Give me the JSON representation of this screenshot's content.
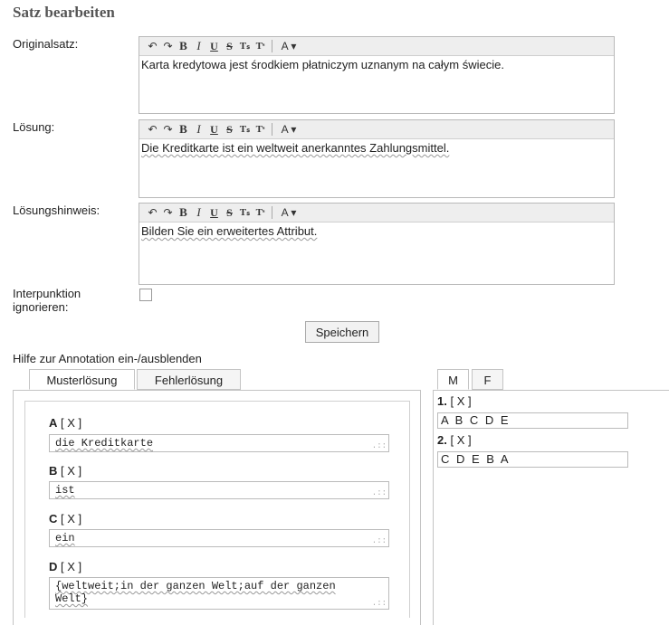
{
  "title": "Satz bearbeiten",
  "toolbar": {
    "undo": "↶",
    "redo": "↷",
    "bold": "B",
    "italic": "I",
    "underline": "U",
    "strike": "S",
    "subscript": "Tₛ",
    "superscript": "Tˢ",
    "color": "A ▾"
  },
  "fields": {
    "original": {
      "label": "Originalsatz:",
      "value": "Karta kredytowa jest środkiem płatniczym uznanym na całym świecie."
    },
    "solution": {
      "label": "Lösung:",
      "value": "Die Kreditkarte ist ein weltweit anerkanntes Zahlungsmittel."
    },
    "hint": {
      "label": "Lösungshinweis:",
      "value": "Bilden Sie ein erweitertes Attribut."
    },
    "punctuation": {
      "label": "Interpunktion ignorieren:",
      "checked": false
    }
  },
  "save_label": "Speichern",
  "annotation_toggle": "Hilfe zur Annotation ein-/ausblenden",
  "tabs": {
    "left": [
      "Musterlösung",
      "Fehlerlösung"
    ],
    "right": [
      "M",
      "F"
    ]
  },
  "annotations": [
    {
      "letter": "A",
      "remove": "[ X ]",
      "value": "die Kreditkarte"
    },
    {
      "letter": "B",
      "remove": "[ X ]",
      "value": "ist"
    },
    {
      "letter": "C",
      "remove": "[ X ]",
      "value": "ein"
    },
    {
      "letter": "D",
      "remove": "[ X ]",
      "value": "{weltweit;in der ganzen Welt;auf der ganzen Welt}"
    }
  ],
  "solutions": [
    {
      "index": "1.",
      "remove": "[ X ]",
      "value": "A B C D E"
    },
    {
      "index": "2.",
      "remove": "[ X ]",
      "value": "C D E B A"
    }
  ]
}
